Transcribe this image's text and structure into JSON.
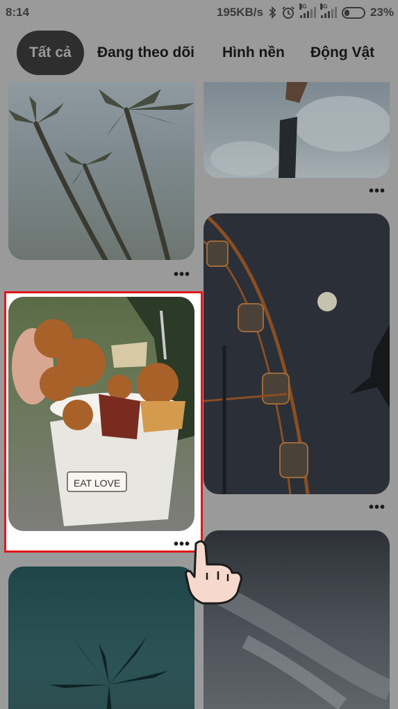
{
  "status": {
    "time": "8:14",
    "speed": "195KB/s",
    "net1": "3G",
    "net2": "4G",
    "battery": "23%"
  },
  "tabs": [
    {
      "label": "Tất cả",
      "active": true
    },
    {
      "label": "Đang theo dõi",
      "active": false
    },
    {
      "label": "Hình nền",
      "active": false
    },
    {
      "label": "Động Vật",
      "active": false
    }
  ],
  "pins": {
    "more_label": "•••",
    "food_brand": "EAT LOVE"
  },
  "colors": {
    "highlight": "#e0161b",
    "overlay": "#9a9a9a",
    "active_tab": "#2e2e2e"
  }
}
